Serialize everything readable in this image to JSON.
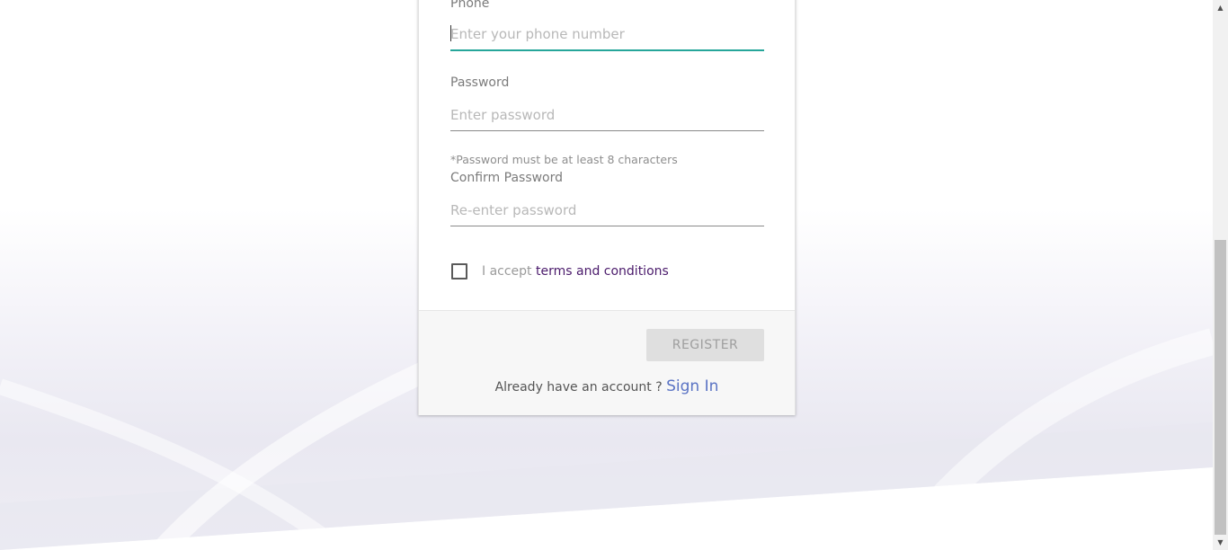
{
  "form": {
    "phone": {
      "label": "Phone",
      "placeholder": "Enter your phone number",
      "value": ""
    },
    "password": {
      "label": "Password",
      "placeholder": "Enter password",
      "value": ""
    },
    "password_hint": "*Password must be at least 8 characters",
    "confirm_password": {
      "label": "Confirm Password",
      "placeholder": "Re-enter password",
      "value": ""
    },
    "terms": {
      "prefix": "I accept ",
      "link": "terms and conditions",
      "checked": false
    }
  },
  "footer": {
    "register_label": "REGISTER",
    "already_text": "Already have an account ? ",
    "signin_label": "Sign In"
  },
  "scrollbar": {
    "up_arrow": "▲",
    "down_arrow": "▼"
  },
  "colors": {
    "active_field": "#26a69a",
    "terms_link": "#4a1a6b",
    "signin_link": "#5a73c4",
    "register_bg": "#dfdfdf"
  }
}
